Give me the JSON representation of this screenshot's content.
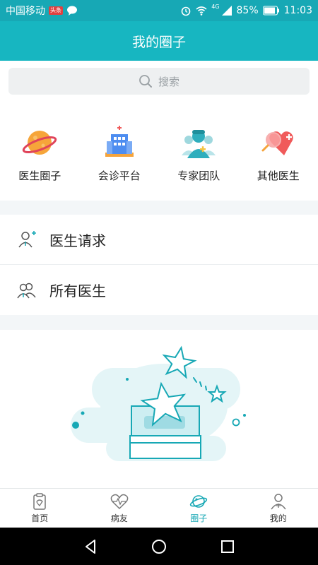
{
  "status_bar": {
    "carrier": "中国移动",
    "badge": "头条",
    "battery": "85%",
    "time": "11:03",
    "network": "4G"
  },
  "header": {
    "title": "我的圈子"
  },
  "search": {
    "placeholder": "搜索"
  },
  "categories": [
    {
      "label": "医生圈子",
      "icon": "planet-icon"
    },
    {
      "label": "会诊平台",
      "icon": "hospital-building-icon"
    },
    {
      "label": "专家团队",
      "icon": "doctor-team-icon"
    },
    {
      "label": "其他医生",
      "icon": "heart-search-icon"
    }
  ],
  "list": [
    {
      "label": "医生请求",
      "icon": "add-doctor-icon"
    },
    {
      "label": "所有医生",
      "icon": "doctors-group-icon"
    }
  ],
  "bottom_nav": [
    {
      "label": "首页",
      "icon": "home-clipboard-icon",
      "active": false
    },
    {
      "label": "病友",
      "icon": "heart-pulse-icon",
      "active": false
    },
    {
      "label": "圈子",
      "icon": "planet-icon",
      "active": true
    },
    {
      "label": "我的",
      "icon": "profile-icon",
      "active": false
    }
  ],
  "colors": {
    "accent": "#17b6c1",
    "status_bar": "#17a8b5",
    "orange": "#f5a43c",
    "red": "#f05a5a"
  }
}
